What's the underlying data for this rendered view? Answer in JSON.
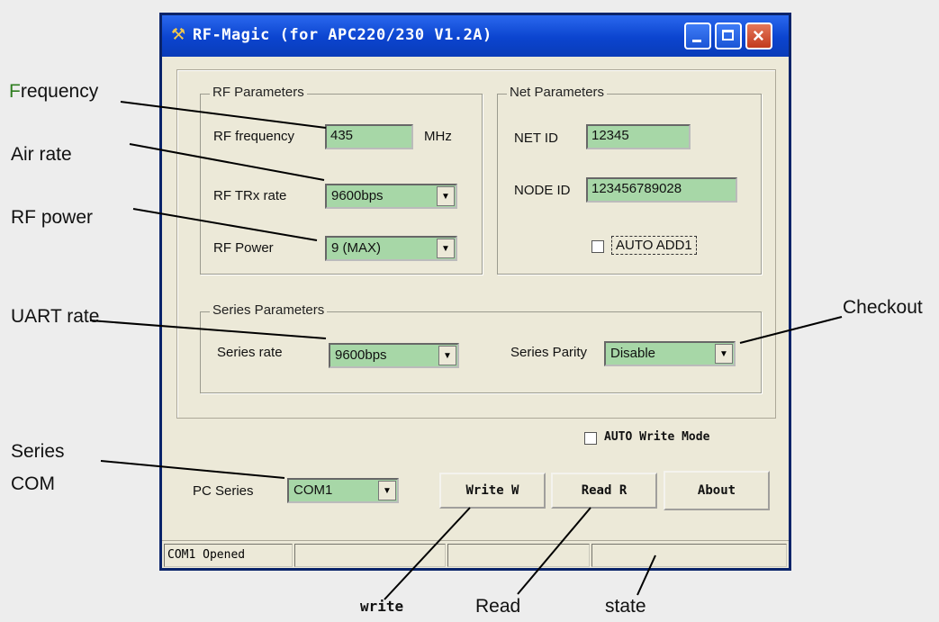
{
  "window": {
    "title": "RF-Magic (for APC220/230 V1.2A)"
  },
  "rf_parameters": {
    "group_title": "RF Parameters",
    "frequency_label": "RF frequency",
    "frequency_value": "435",
    "frequency_unit": "MHz",
    "trx_rate_label": "RF TRx rate",
    "trx_rate_value": "9600bps",
    "power_label": "RF Power",
    "power_value": "9 (MAX)"
  },
  "net_parameters": {
    "group_title": "Net Parameters",
    "net_id_label": "NET ID",
    "net_id_value": "12345",
    "node_id_label": "NODE ID",
    "node_id_value": "123456789028",
    "auto_add_label": "AUTO ADD1",
    "auto_add_checked": false
  },
  "series_parameters": {
    "group_title": "Series Parameters",
    "rate_label": "Series rate",
    "rate_value": "9600bps",
    "parity_label": "Series Parity",
    "parity_value": "Disable"
  },
  "auto_write": {
    "label": "AUTO Write Mode",
    "checked": false
  },
  "pc_series": {
    "label": "PC Series",
    "value": "COM1"
  },
  "buttons": {
    "write": "Write W",
    "read": "Read R",
    "about": "About"
  },
  "status_bar": [
    "COM1 Opened",
    "",
    "",
    ""
  ],
  "annotations": {
    "frequency_first": "F",
    "frequency_rest": "requency",
    "air_rate": "Air rate",
    "rf_power": "RF power",
    "uart_rate": "UART rate",
    "series_com_line1": "Series",
    "series_com_line2": "COM",
    "checkout": "Checkout",
    "write": "write",
    "read": "Read",
    "state": "state"
  }
}
